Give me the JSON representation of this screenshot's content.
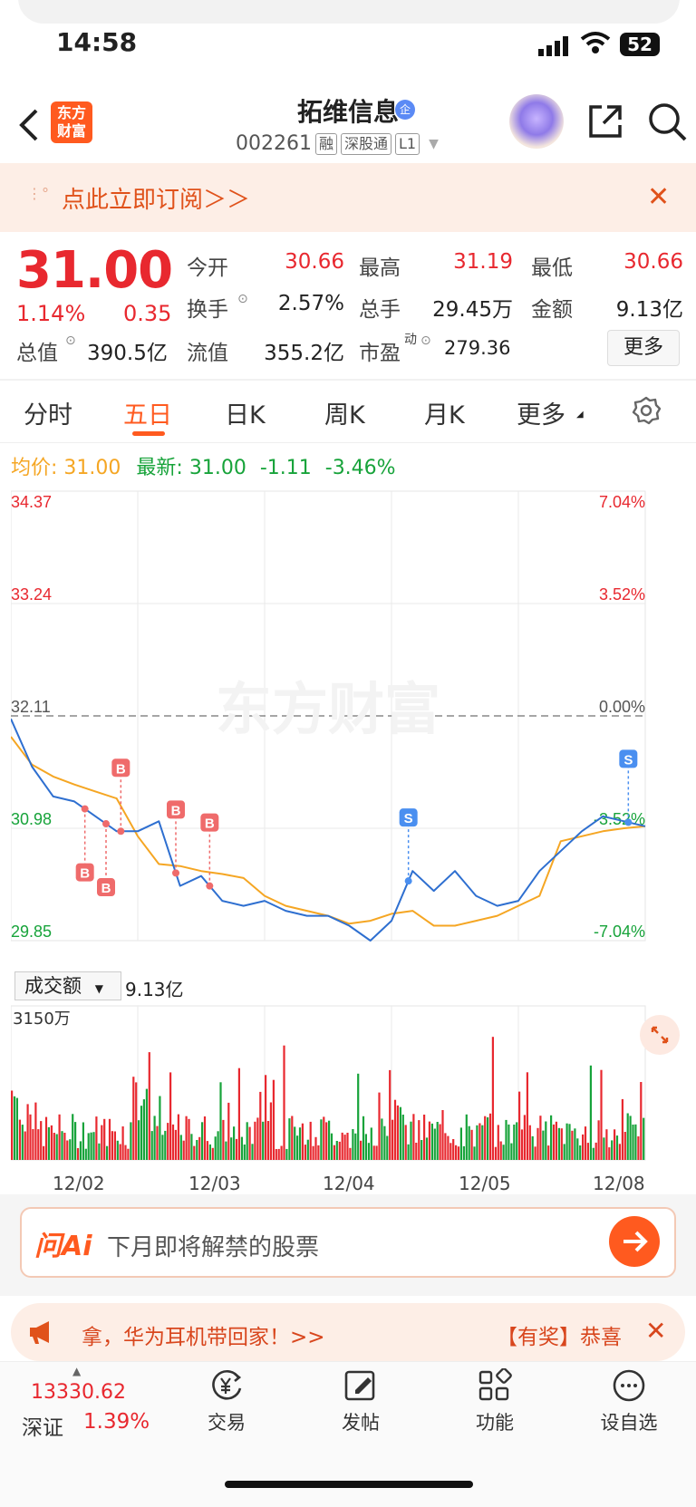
{
  "status_bar": {
    "time": "14:58",
    "battery": "52"
  },
  "header": {
    "app_logo": "东方\n财富",
    "stock_name": "拓维信息",
    "name_badge": "企",
    "code": "002261",
    "tags": [
      "融",
      "深股通",
      "L1"
    ]
  },
  "subscribe_banner": {
    "text": "点此立即订阅＞＞",
    "close": "✕"
  },
  "quote": {
    "price": "31.00",
    "change_pct": "1.14%",
    "change": "0.35",
    "rows": [
      [
        {
          "label": "今开",
          "value": "30.66",
          "color": "red"
        },
        {
          "label": "最高",
          "value": "31.19",
          "color": "red"
        },
        {
          "label": "最低",
          "value": "30.66",
          "color": "red"
        }
      ],
      [
        {
          "label": "换手",
          "value": "2.57%",
          "color": "black"
        },
        {
          "label": "总手",
          "value": "29.45万",
          "color": "black"
        },
        {
          "label": "金额",
          "value": "9.13亿",
          "color": "black"
        }
      ]
    ],
    "row3": {
      "total_cap_label": "总值",
      "total_cap_value": "390.5亿",
      "float_label": "流值",
      "float_value": "355.2亿",
      "pe_label": "市盈",
      "pe_sup": "动",
      "pe_value": "279.36"
    },
    "more_button": "更多"
  },
  "period_tabs": [
    "分时",
    "五日",
    "日K",
    "周K",
    "月K",
    "更多"
  ],
  "active_tab": "五日",
  "avg_line": {
    "avg_label": "均价:",
    "avg_value": "31.00",
    "latest_label": "最新:",
    "latest_value": "31.00",
    "latest_change": "-1.11",
    "latest_pct": "-3.46%"
  },
  "chart_data": {
    "type": "line",
    "price_axis": [
      "34.37",
      "33.24",
      "32.11",
      "30.98",
      "29.85"
    ],
    "pct_axis": [
      "7.04%",
      "3.52%",
      "0.00%",
      "-3.52%",
      "-7.04%"
    ],
    "ylim": [
      29.85,
      34.37
    ],
    "reference_price": 32.11,
    "dates": [
      "12/02",
      "12/03",
      "12/04",
      "12/05",
      "12/08"
    ],
    "series": [
      {
        "name": "price",
        "color": "#2e6fd0",
        "values": [
          32.08,
          31.6,
          31.3,
          31.25,
          31.1,
          30.95,
          30.95,
          31.05,
          30.4,
          30.5,
          30.25,
          30.2,
          30.25,
          30.15,
          30.1,
          30.1,
          30.0,
          29.85,
          30.05,
          30.55,
          30.35,
          30.55,
          30.3,
          30.2,
          30.25,
          30.55,
          30.75,
          30.95,
          31.1,
          31.05,
          31.0
        ]
      },
      {
        "name": "avg",
        "color": "#f5a623",
        "values": [
          31.9,
          31.62,
          31.5,
          31.42,
          31.35,
          31.28,
          30.9,
          30.62,
          30.6,
          30.55,
          30.52,
          30.48,
          30.3,
          30.2,
          30.15,
          30.1,
          30.02,
          30.05,
          30.12,
          30.15,
          30.0,
          30.0,
          30.05,
          30.1,
          30.2,
          30.3,
          30.85,
          30.9,
          30.95,
          30.98,
          31.0
        ]
      }
    ],
    "trade_marks": [
      "B",
      "B",
      "B",
      "B",
      "B",
      "S",
      "S"
    ],
    "volume_label": "成交额",
    "volume_total": "9.13亿",
    "volume_max": "3150万"
  },
  "ai_search": {
    "logo": "问Ai",
    "placeholder": "下月即将解禁的股票"
  },
  "marquee": {
    "text": "拿，华为耳机带回家！>>",
    "text2": "【有奖】恭喜",
    "close": "✕"
  },
  "bottom_bar": {
    "index_value": "13330.62",
    "index_name": "深证",
    "index_pct": "1.39%",
    "items": [
      "交易",
      "发帖",
      "功能",
      "设自选"
    ]
  },
  "colors": {
    "accent": "#ff5a1f",
    "up": "#e8282f",
    "down": "#17a33a",
    "price_line": "#2e6fd0",
    "avg_line": "#f5a623"
  }
}
